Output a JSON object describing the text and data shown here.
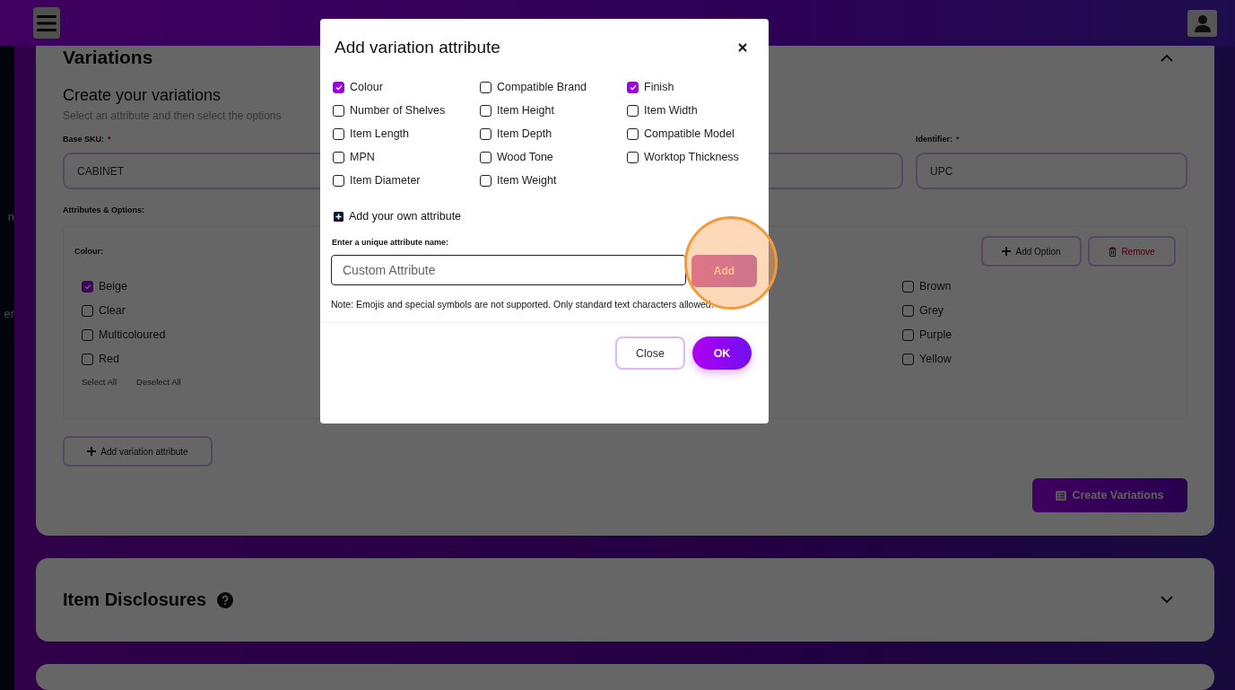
{
  "sidebar": {
    "items": [
      {
        "label": "n"
      },
      {
        "label": "er"
      }
    ]
  },
  "variations": {
    "title": "Variations",
    "expanded": true,
    "heading": "Create your variations",
    "subtitle": "Select an attribute and then select the options",
    "fields": [
      {
        "label": "Base SKU:",
        "required_mark": "*",
        "value": "CABINET"
      },
      {
        "label": "Identifier:",
        "required_mark": "*",
        "value": "UPC"
      }
    ],
    "attributes_label": "Attributes & Options:",
    "attribute": {
      "name": "Colour:",
      "add_option": "Add Option",
      "remove": "Remove",
      "columns": [
        {
          "options": [
            {
              "label": "Beige",
              "checked": true
            },
            {
              "label": "Clear",
              "checked": false
            },
            {
              "label": "Multicoloured",
              "checked": false
            },
            {
              "label": "Red",
              "checked": false
            }
          ]
        },
        {
          "options": [
            {
              "label": "Brown",
              "checked": false
            },
            {
              "label": "Grey",
              "checked": false
            },
            {
              "label": "Purple",
              "checked": false
            },
            {
              "label": "Yellow",
              "checked": false
            }
          ]
        }
      ],
      "select_all": "Select All",
      "deselect_all": "Deselect All"
    },
    "add_attribute": "Add variation attribute",
    "create": "Create Variations"
  },
  "disclosures": {
    "title": "Item Disclosures",
    "expanded": false
  },
  "dialog": {
    "title": "Add variation attribute",
    "attributes": [
      {
        "label": "Colour",
        "checked": true
      },
      {
        "label": "Compatible Brand",
        "checked": false
      },
      {
        "label": "Finish",
        "checked": true
      },
      {
        "label": "Number of Shelves",
        "checked": false
      },
      {
        "label": "Item Height",
        "checked": false
      },
      {
        "label": "Item Width",
        "checked": false
      },
      {
        "label": "Item Length",
        "checked": false
      },
      {
        "label": "Item Depth",
        "checked": false
      },
      {
        "label": "Compatible Model",
        "checked": false
      },
      {
        "label": "MPN",
        "checked": false
      },
      {
        "label": "Wood Tone",
        "checked": false
      },
      {
        "label": "Worktop Thickness",
        "checked": false
      },
      {
        "label": "Item Diameter",
        "checked": false
      },
      {
        "label": "Item Weight",
        "checked": false
      }
    ],
    "own_attribute": "Add your own attribute",
    "name_label": "Enter a unique attribute name:",
    "placeholder": "Custom Attribute",
    "add": "Add",
    "note": "Note: Emojis and special symbols are not supported. Only standard text characters allowed.",
    "close": "Close",
    "ok": "OK"
  }
}
